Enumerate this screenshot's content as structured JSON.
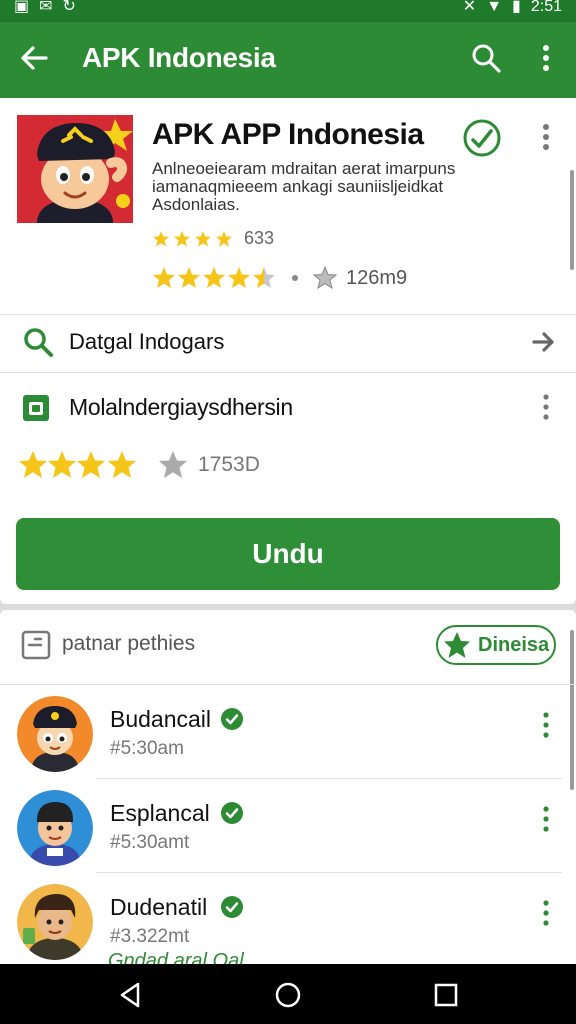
{
  "status_bar": {
    "left_icons": [
      "sim-icon",
      "notification-icon",
      "sync-icon"
    ],
    "right_icons": [
      "mute-icon",
      "wifi-icon",
      "signal-icon",
      "battery-icon"
    ],
    "time": "2:51"
  },
  "app_bar": {
    "title": "APK Indonesia",
    "back_icon": "arrow-left-icon",
    "search_icon": "search-icon",
    "more_icon": "more-vert-icon"
  },
  "app": {
    "title": "APK APP Indonesia",
    "description": "Anlneoeiearam mdraitan aerat imarpuns iamanaqmieeem ankagi sauniisljeidkat Asdonlaias.",
    "rating_small_stars": 4,
    "rating_small_text": "633",
    "rating_big_stars": 4.5,
    "downloads_text": "126m9"
  },
  "search_row": {
    "label": "Datgal Indogars"
  },
  "category_row": {
    "label": "Molalndergiaysdhersin"
  },
  "rating_row": {
    "stars": 3.5,
    "text": "1753D"
  },
  "install_button": {
    "label": "Undu"
  },
  "section": {
    "title": "patnar pethies",
    "chip_label": "Dineisa"
  },
  "list": [
    {
      "name": "Budancail",
      "time": "#5:30am"
    },
    {
      "name": "Esplancal",
      "time": "#5:30amt"
    },
    {
      "name": "Dudenatil",
      "time": "#3.322mt"
    }
  ],
  "cutoff_text": "Gndad aral Oal",
  "colors": {
    "primary": "#2e8b35",
    "primary_dark": "#1f7a2b",
    "star": "#f5c518"
  }
}
